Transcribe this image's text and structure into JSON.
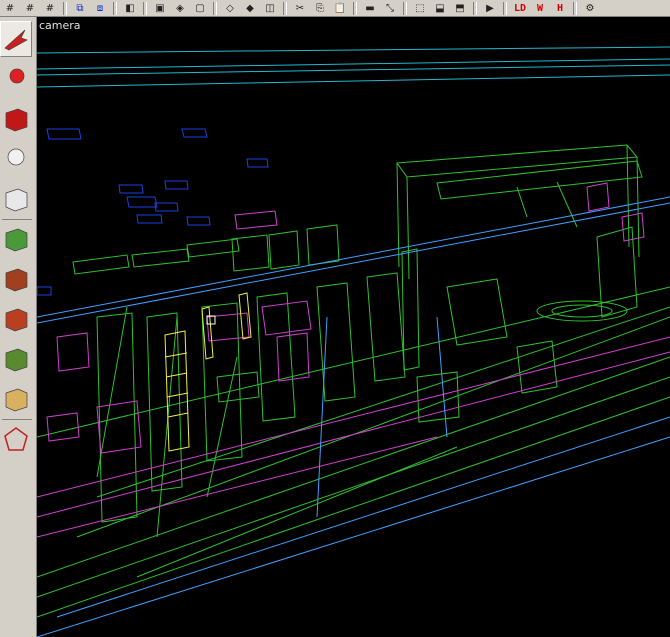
{
  "toolbar": {
    "buttons": [
      {
        "name": "grid-1-icon",
        "glyph": "#"
      },
      {
        "name": "grid-2-icon",
        "glyph": "#"
      },
      {
        "name": "grid-4-icon",
        "glyph": "#"
      },
      {
        "name": "sep"
      },
      {
        "name": "select-brushes-icon",
        "glyph": "⧉"
      },
      {
        "name": "select-entities-icon",
        "glyph": "⧈"
      },
      {
        "name": "sep"
      },
      {
        "name": "flip-icon",
        "glyph": "◧"
      },
      {
        "name": "sep"
      },
      {
        "name": "csg-subtract-icon",
        "glyph": "▣"
      },
      {
        "name": "csg-merge-icon",
        "glyph": "◈"
      },
      {
        "name": "hollow-icon",
        "glyph": "▢"
      },
      {
        "name": "sep"
      },
      {
        "name": "clipper-icon",
        "glyph": "◇"
      },
      {
        "name": "bevel-icon",
        "glyph": "◆"
      },
      {
        "name": "brush-icon",
        "glyph": "◫"
      },
      {
        "name": "sep"
      },
      {
        "name": "cut-icon",
        "glyph": "✂"
      },
      {
        "name": "copy-icon",
        "glyph": "⎘"
      },
      {
        "name": "paste-icon",
        "glyph": "📋"
      },
      {
        "name": "sep"
      },
      {
        "name": "texture-lock-icon",
        "glyph": "▬"
      },
      {
        "name": "scale-texture-icon",
        "glyph": "⤡"
      },
      {
        "name": "sep"
      },
      {
        "name": "camera-icon",
        "glyph": "⬚"
      },
      {
        "name": "cubic-clip-icon",
        "glyph": "⬓"
      },
      {
        "name": "bbox-icon",
        "glyph": "⬒"
      },
      {
        "name": "sep"
      },
      {
        "name": "patch-icon",
        "glyph": "▶"
      },
      {
        "name": "sep"
      },
      {
        "name": "view-xy-icon",
        "glyph": "LD"
      },
      {
        "name": "view-w-icon",
        "glyph": "W"
      },
      {
        "name": "view-h-icon",
        "glyph": "H"
      },
      {
        "name": "sep"
      },
      {
        "name": "settings-icon",
        "glyph": "⚙"
      }
    ]
  },
  "sidebar": {
    "tools": [
      {
        "name": "select-arrow-icon",
        "color": "#cc2020"
      },
      {
        "name": "entity-pin-icon",
        "color": "#e02020"
      },
      {
        "name": "brush-red-icon",
        "color": "#c01818"
      },
      {
        "name": "light-bulb-icon",
        "color": "#f0f0f0"
      },
      {
        "name": "cube-white-icon",
        "color": "#e8e8e8"
      },
      {
        "name": "texture-green-icon",
        "color": "#4a9a3a"
      },
      {
        "name": "texture-brick-icon",
        "color": "#a04020"
      },
      {
        "name": "texture-rust-icon",
        "color": "#b84020"
      },
      {
        "name": "texture-grass-icon",
        "color": "#5a8a30"
      },
      {
        "name": "texture-sand-icon",
        "color": "#d8b060"
      },
      {
        "name": "vertex-edit-icon",
        "color": "#c02020"
      }
    ]
  },
  "viewport": {
    "label": "camera"
  }
}
